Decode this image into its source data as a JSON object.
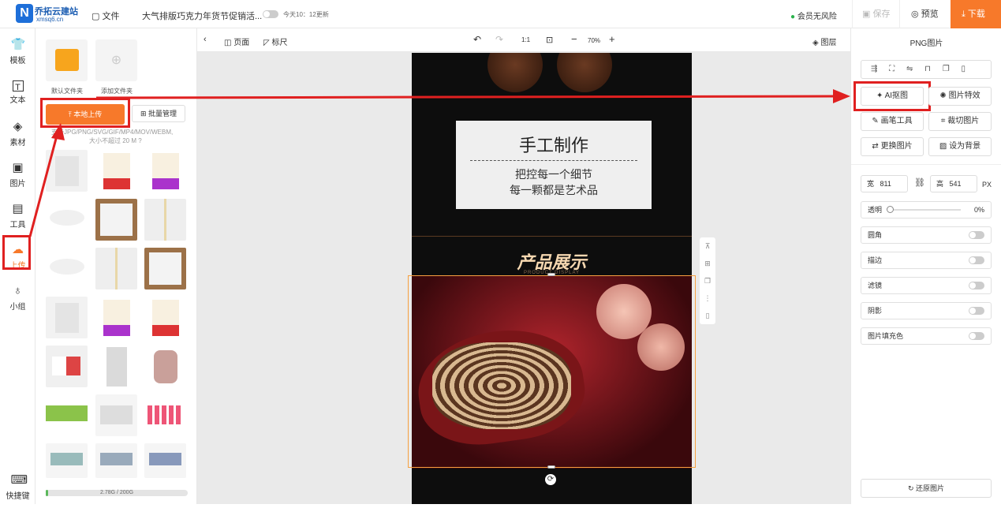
{
  "header": {
    "brand_name": "乔拓云建站",
    "brand_domain": "xmsq6.cn",
    "file_menu": "文件",
    "doc_title": "大气排版巧克力年货节促销活...",
    "update_text": "今天10：12更新",
    "member_status": "会员无风险",
    "save_label": "保存",
    "preview_label": "预览",
    "download_label": "下载"
  },
  "rail": [
    {
      "label": "模板",
      "icon": "shirt-icon"
    },
    {
      "label": "文本",
      "icon": "text-icon"
    },
    {
      "label": "素材",
      "icon": "shapes-icon"
    },
    {
      "label": "图片",
      "icon": "image-icon"
    },
    {
      "label": "工具",
      "icon": "toolbox-icon"
    },
    {
      "label": "上传",
      "icon": "upload-cloud-icon"
    },
    {
      "label": "小组",
      "icon": "group-icon"
    },
    {
      "label": "快捷键",
      "icon": "keyboard-icon"
    }
  ],
  "panel": {
    "folder_default": "默认文件夹",
    "folder_add": "添加文件夹",
    "upload_button": "本地上传",
    "batch_button": "批量管理",
    "hint_line1": "支持JPG/PNG/SVG/GIF/MP4/MOV/WEBM,",
    "hint_line2": "大小不超过 20 M",
    "storage": "2.78G / 200G",
    "storage_used_fraction": 0.014
  },
  "canvas_toolbar": {
    "page_label": "页面",
    "ruler_label": "标尺",
    "ratio": "1:1",
    "zoom": "70%",
    "layers_label": "图层"
  },
  "design": {
    "card_title": "手工制作",
    "card_line1": "把控每一个细节",
    "card_line2": "每一颗都是艺术品",
    "section_title": "产品展示",
    "section_sub": "PRODUCT DISPLAY"
  },
  "right": {
    "title": "PNG图片",
    "ai_cutout": "AI抠图",
    "effects": "图片特效",
    "brush": "画笔工具",
    "crop": "裁切图片",
    "replace": "更换图片",
    "set_bg": "设为背景",
    "width_label": "宽",
    "width_value": "811",
    "height_label": "高",
    "height_value": "541",
    "unit": "PX",
    "opacity_label": "透明",
    "opacity_value": "0%",
    "corner": "圆角",
    "stroke": "描边",
    "filter": "滤镜",
    "shadow": "阴影",
    "fill": "图片填充色",
    "restore": "还原图片"
  },
  "colors": {
    "accent": "#f7792a",
    "highlight": "#e02020",
    "brand": "#1e6fd9"
  }
}
